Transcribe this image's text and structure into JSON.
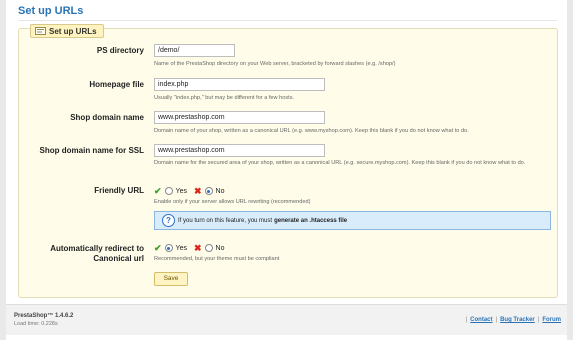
{
  "page": {
    "title": "Set up URLs"
  },
  "panel": {
    "legend": "Set up URLs",
    "ps_directory": {
      "label": "PS directory",
      "value": "/demo/",
      "help": "Name of the PrestaShop directory on your Web server, bracketed by forward slashes (e.g. /shop/)"
    },
    "homepage_file": {
      "label": "Homepage file",
      "value": "index.php",
      "help": "Usually \"index.php,\" but may be different for a few hosts."
    },
    "shop_domain": {
      "label": "Shop domain name",
      "value": "www.prestashop.com",
      "help": "Domain name of your shop, written as a canonical URL (e.g. www.myshop.com). Keep this blank if you do not know what to do."
    },
    "shop_domain_ssl": {
      "label": "Shop domain name for SSL",
      "value": "www.prestashop.com",
      "help": "Domain name for the secured area of your shop, written as a canonical URL (e.g. secure.myshop.com). Keep this blank if you do not know what to do."
    },
    "friendly_url": {
      "label": "Friendly URL",
      "yes_label": "Yes",
      "no_label": "No",
      "selected": "No",
      "help": "Enable only if your server allows URL rewriting (recommended)",
      "info_text": "If you turn on this feature, you must",
      "info_link": "generate an .htaccess file"
    },
    "auto_redirect": {
      "label_line1": "Automatically redirect to",
      "label_line2": "Canonical url",
      "yes_label": "Yes",
      "no_label": "No",
      "selected": "Yes",
      "help": "Recommended, but your theme must be compliant"
    },
    "save_label": "Save"
  },
  "footer": {
    "brand": "PrestaShop™ 1.4.6.2",
    "load_time": "Load time: 0.228s",
    "links": [
      "Contact",
      "Bug Tracker",
      "Forum"
    ]
  },
  "colors": {
    "accent": "#2a74b6",
    "panel_bg": "#fffdea",
    "info_bg": "#d9ecfb"
  }
}
